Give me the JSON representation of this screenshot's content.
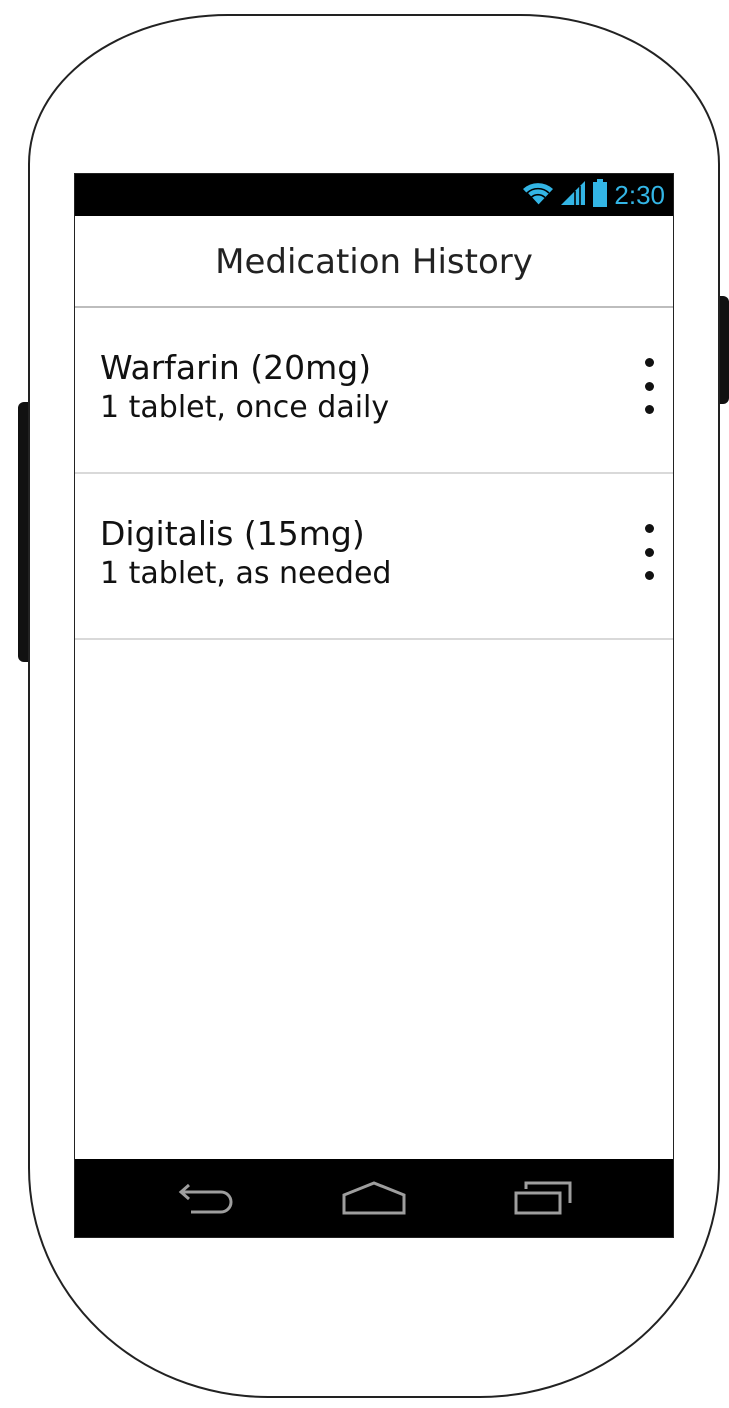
{
  "status_bar": {
    "time": "2:30",
    "icons": [
      "wifi-icon",
      "signal-icon",
      "battery-icon"
    ],
    "accent_color": "#33b5e5"
  },
  "action_bar": {
    "title": "Medication History"
  },
  "medications": [
    {
      "name": "Warfarin (20mg)",
      "dosage": "1 tablet, once daily",
      "menu_icon": "overflow-menu-icon"
    },
    {
      "name": "Digitalis (15mg)",
      "dosage": "1 tablet, as needed",
      "menu_icon": "overflow-menu-icon"
    }
  ],
  "nav_bar": {
    "buttons": [
      "back-icon",
      "home-icon",
      "recent-apps-icon"
    ]
  }
}
